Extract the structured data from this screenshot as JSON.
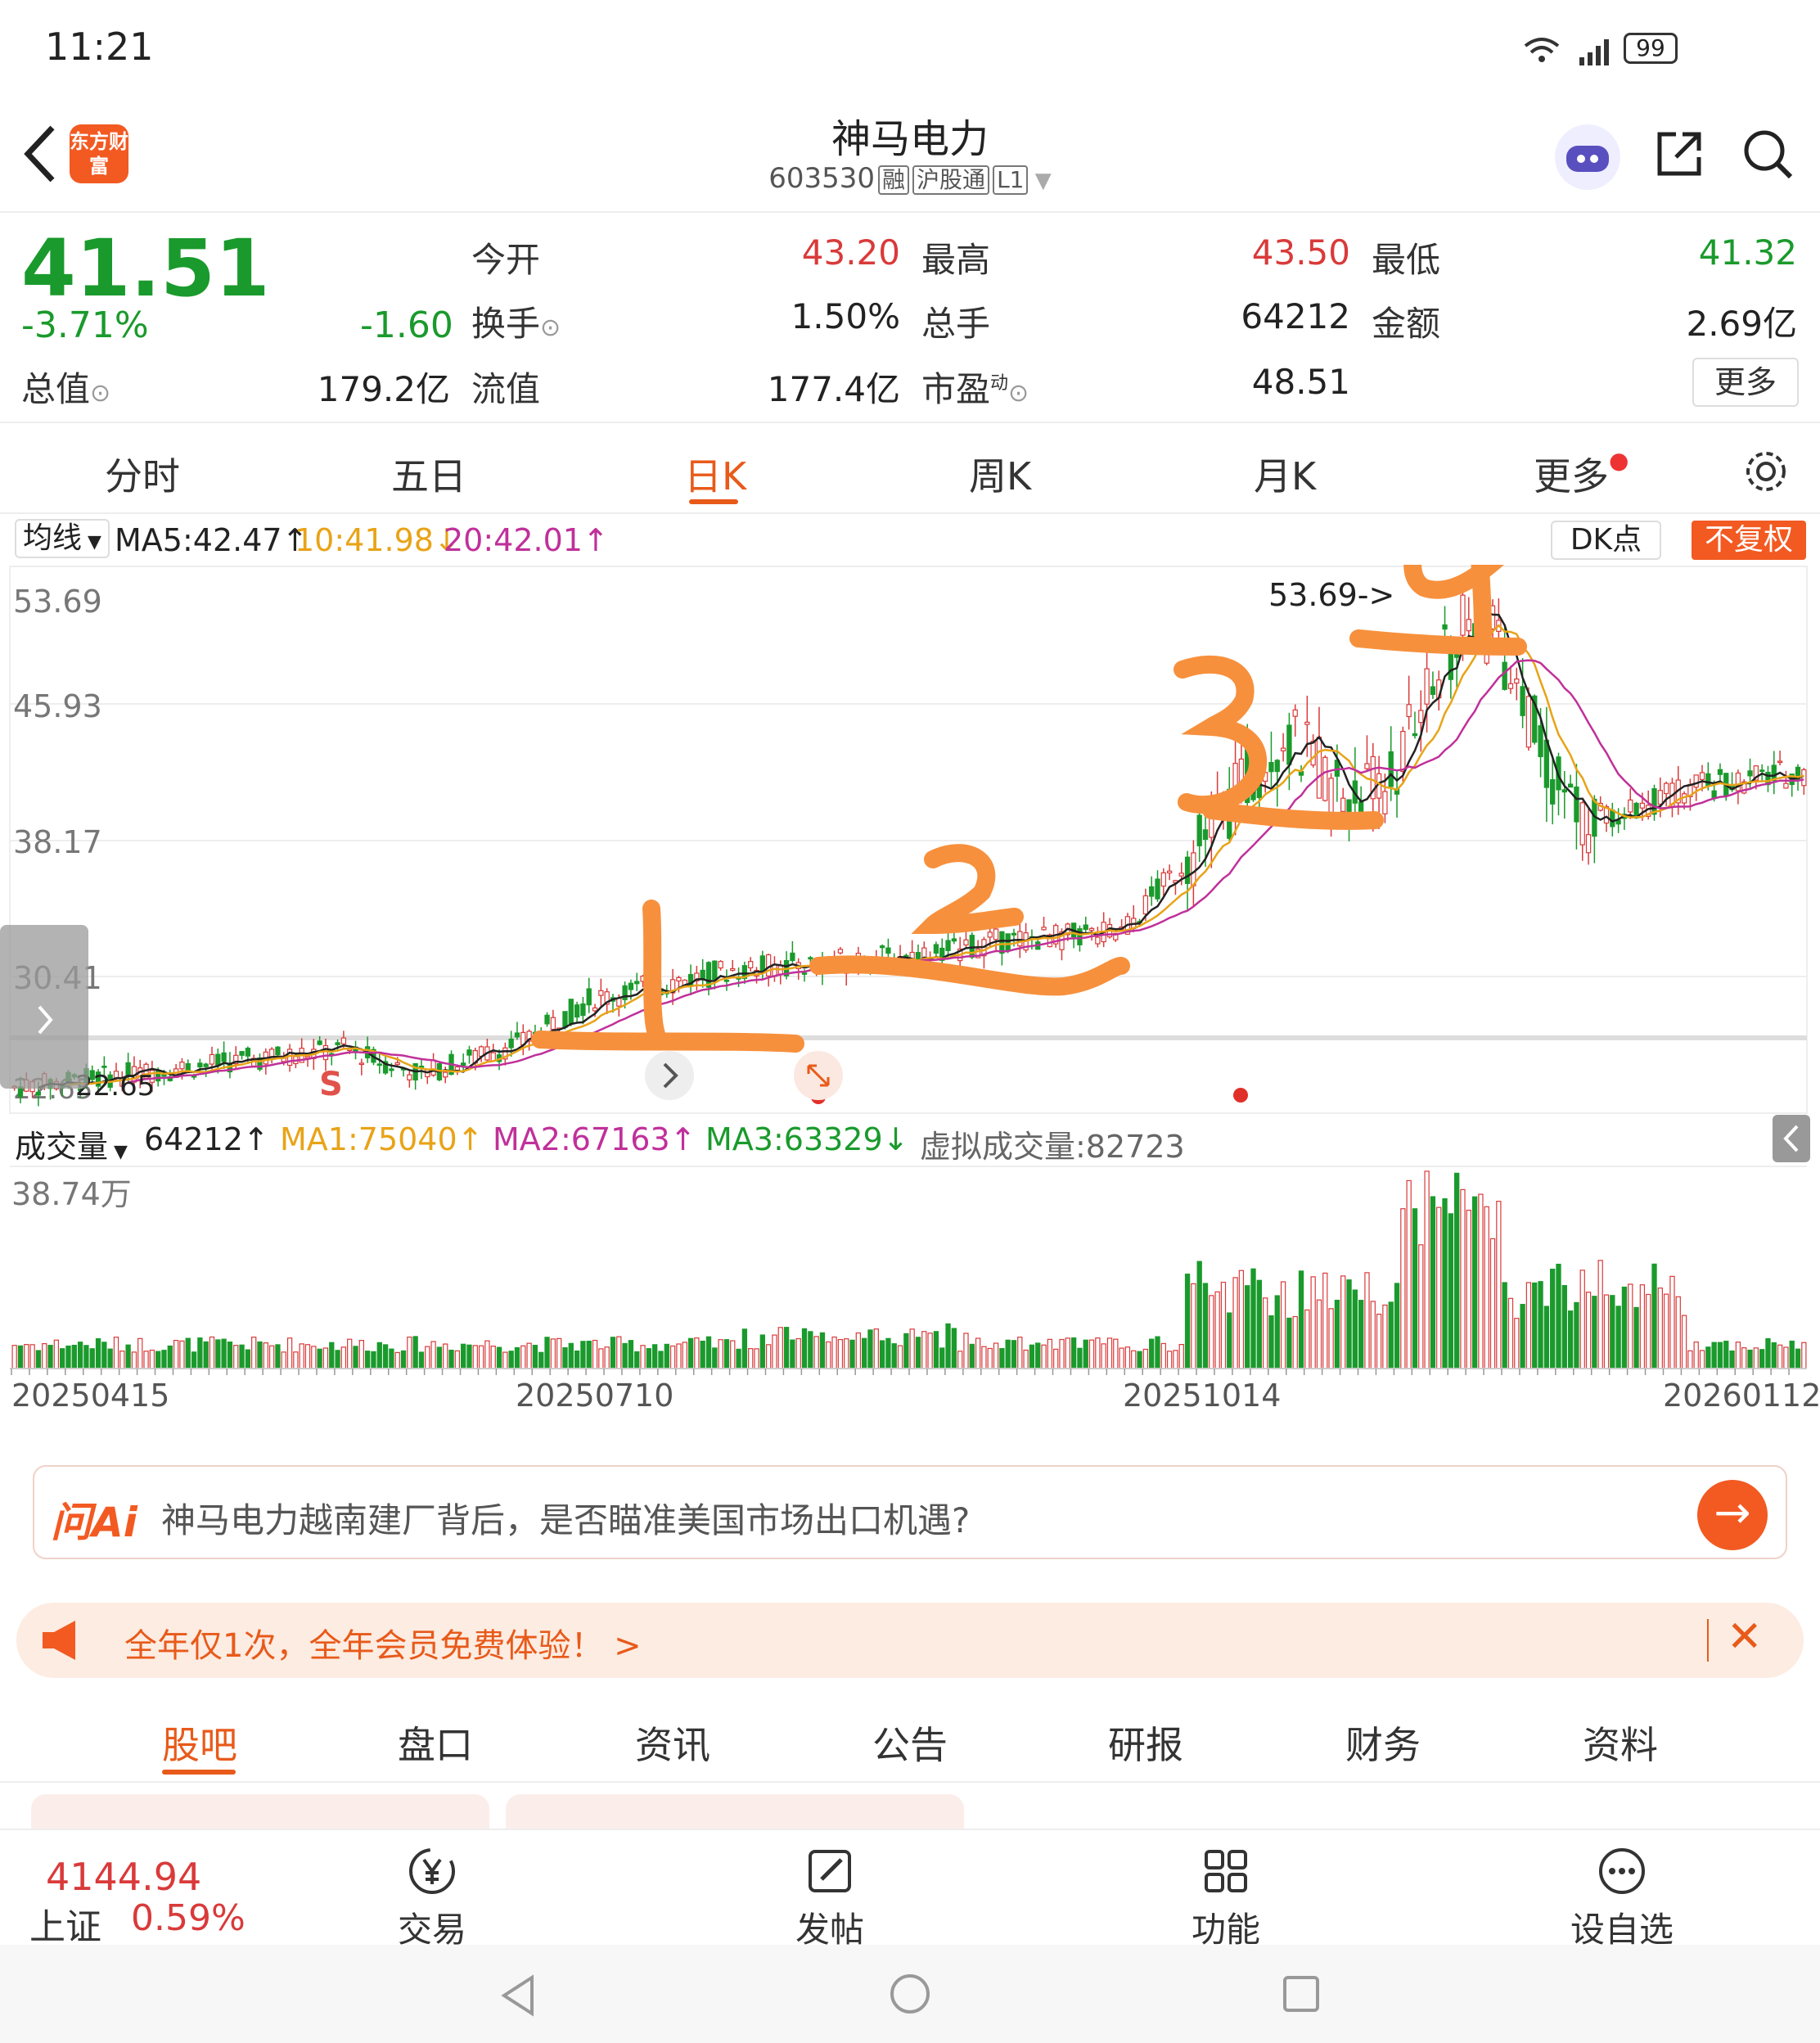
{
  "status": {
    "time": "11:21",
    "battery": "99"
  },
  "header": {
    "app_logo": "东方财富",
    "name": "神马电力",
    "code": "603530",
    "tags": [
      "融",
      "沪股通",
      "L1"
    ]
  },
  "quote": {
    "price": "41.51",
    "pct": "-3.71%",
    "change": "-1.60",
    "open_label": "今开",
    "open": "43.20",
    "high_label": "最高",
    "high": "43.50",
    "low_label": "最低",
    "low": "41.32",
    "turnover_label": "换手",
    "turnover": "1.50%",
    "volume_label": "总手",
    "volume": "64212",
    "amount_label": "金额",
    "amount": "2.69亿",
    "mktcap_label": "总值",
    "mktcap": "179.2亿",
    "float_label": "流值",
    "float": "177.4亿",
    "pe_label": "市盈",
    "pe_sup": "动",
    "pe": "48.51",
    "more": "更多"
  },
  "tabs": [
    "分时",
    "五日",
    "日K",
    "周K",
    "月K",
    "更多"
  ],
  "ma_legend": {
    "label": "均线",
    "ma5": "MA5:42.47↑",
    "ma10": "10:41.98↓",
    "ma20": "20:42.01↑",
    "dk": "DK点",
    "fq": "不复权"
  },
  "kline": {
    "axis": [
      "53.69",
      "45.93",
      "38.17",
      "30.41",
      "22.65"
    ],
    "max_label": "53.69->",
    "min_label": "22.65",
    "signal": "S",
    "annotations": [
      "1",
      "2",
      "3",
      "4"
    ]
  },
  "volume": {
    "label": "成交量",
    "value": "64212↑",
    "ma1": "MA1:75040↑",
    "ma2": "MA2:67163↑",
    "ma3": "MA3:63329↓",
    "virtual": "虚拟成交量:82723",
    "axis_max": "38.74万"
  },
  "dates": [
    "20250415",
    "20250710",
    "20251014",
    "20260112"
  ],
  "ai": {
    "logo": "问Ai",
    "text": "神马电力越南建厂背后，是否瞄准美国市场出口机遇?"
  },
  "promo": {
    "text": "全年仅1次，全年会员免费体验！ >"
  },
  "subtabs": [
    "股吧",
    "盘口",
    "资讯",
    "公告",
    "研报",
    "财务",
    "资料"
  ],
  "bottom": {
    "index_value": "4144.94",
    "index_name": "上证",
    "index_pct": "0.59%",
    "items": [
      "交易",
      "发帖",
      "功能",
      "设自选"
    ]
  },
  "colors": {
    "up": "#d93a3a",
    "down": "#1a9a2c",
    "accent": "#f25a22",
    "ma5": "#222222",
    "ma10": "#e8a317",
    "ma20": "#c0309a",
    "annot": "#f7903c"
  }
}
